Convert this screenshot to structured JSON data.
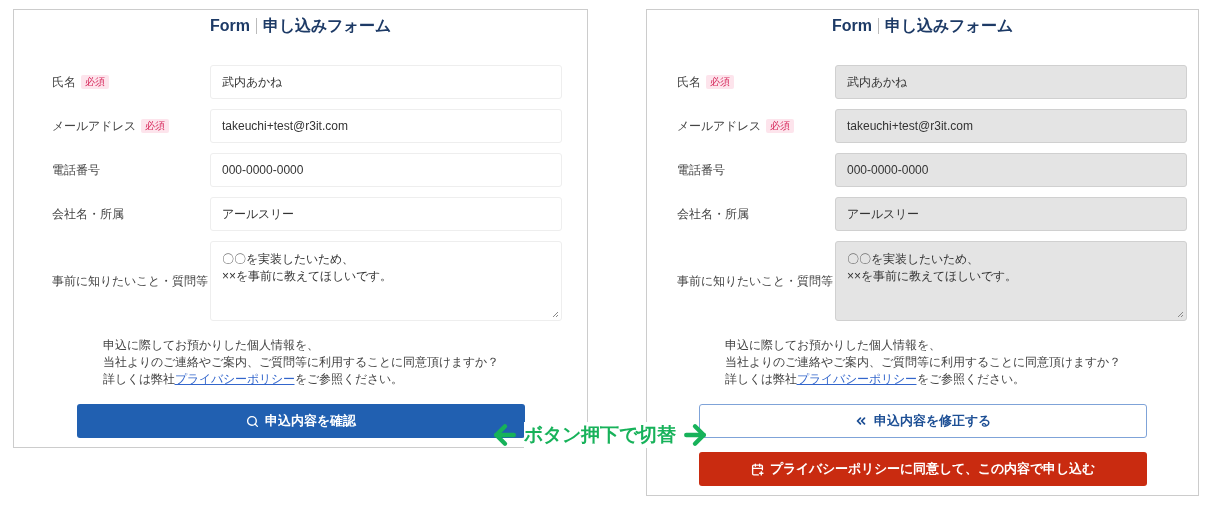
{
  "panels": [
    {
      "title_en": "Form",
      "title_ja": "申し込みフォーム",
      "readonly": false,
      "fields": [
        {
          "label": "氏名",
          "required": true,
          "badge": "必須",
          "value": "武内あかね",
          "kind": "text"
        },
        {
          "label": "メールアドレス",
          "required": true,
          "badge": "必須",
          "value": "takeuchi+test@r3it.com",
          "kind": "text"
        },
        {
          "label": "電話番号",
          "required": false,
          "value": "000-0000-0000",
          "kind": "text"
        },
        {
          "label": "会社名・所属",
          "required": false,
          "value": "アールスリー",
          "kind": "text"
        },
        {
          "label": "事前に知りたいこと・質問等",
          "required": false,
          "value": "〇〇を実装したいため、\n××を事前に教えてほしいです。",
          "kind": "textarea"
        }
      ],
      "notice_lines": [
        "申込に際してお預かりした個人情報を、",
        "当社よりのご連絡やご案内、ご質問等に利用することに同意頂けますか？"
      ],
      "policy_line": {
        "prefix": "詳しくは弊社",
        "link": "プライバシーポリシー",
        "suffix": "をご参照ください。"
      },
      "buttons": [
        {
          "kind": "confirm",
          "label": "申込内容を確認"
        }
      ]
    },
    {
      "title_en": "Form",
      "title_ja": "申し込みフォーム",
      "readonly": true,
      "fields": [
        {
          "label": "氏名",
          "required": true,
          "badge": "必須",
          "value": "武内あかね",
          "kind": "text"
        },
        {
          "label": "メールアドレス",
          "required": true,
          "badge": "必須",
          "value": "takeuchi+test@r3it.com",
          "kind": "text"
        },
        {
          "label": "電話番号",
          "required": false,
          "value": "000-0000-0000",
          "kind": "text"
        },
        {
          "label": "会社名・所属",
          "required": false,
          "value": "アールスリー",
          "kind": "text"
        },
        {
          "label": "事前に知りたいこと・質問等",
          "required": false,
          "value": "〇〇を実装したいため、\n××を事前に教えてほしいです。",
          "kind": "textarea"
        }
      ],
      "notice_lines": [
        "申込に際してお預かりした個人情報を、",
        "当社よりのご連絡やご案内、ご質問等に利用することに同意頂けますか？"
      ],
      "policy_line": {
        "prefix": "詳しくは弊社",
        "link": "プライバシーポリシー",
        "suffix": "をご参照ください。"
      },
      "buttons": [
        {
          "kind": "edit",
          "label": "申込内容を修正する"
        },
        {
          "kind": "submit",
          "label": "プライバシーポリシーに同意して、この内容で申し込む"
        }
      ]
    }
  ],
  "annotation": {
    "text": "ボタン押下で切替"
  }
}
